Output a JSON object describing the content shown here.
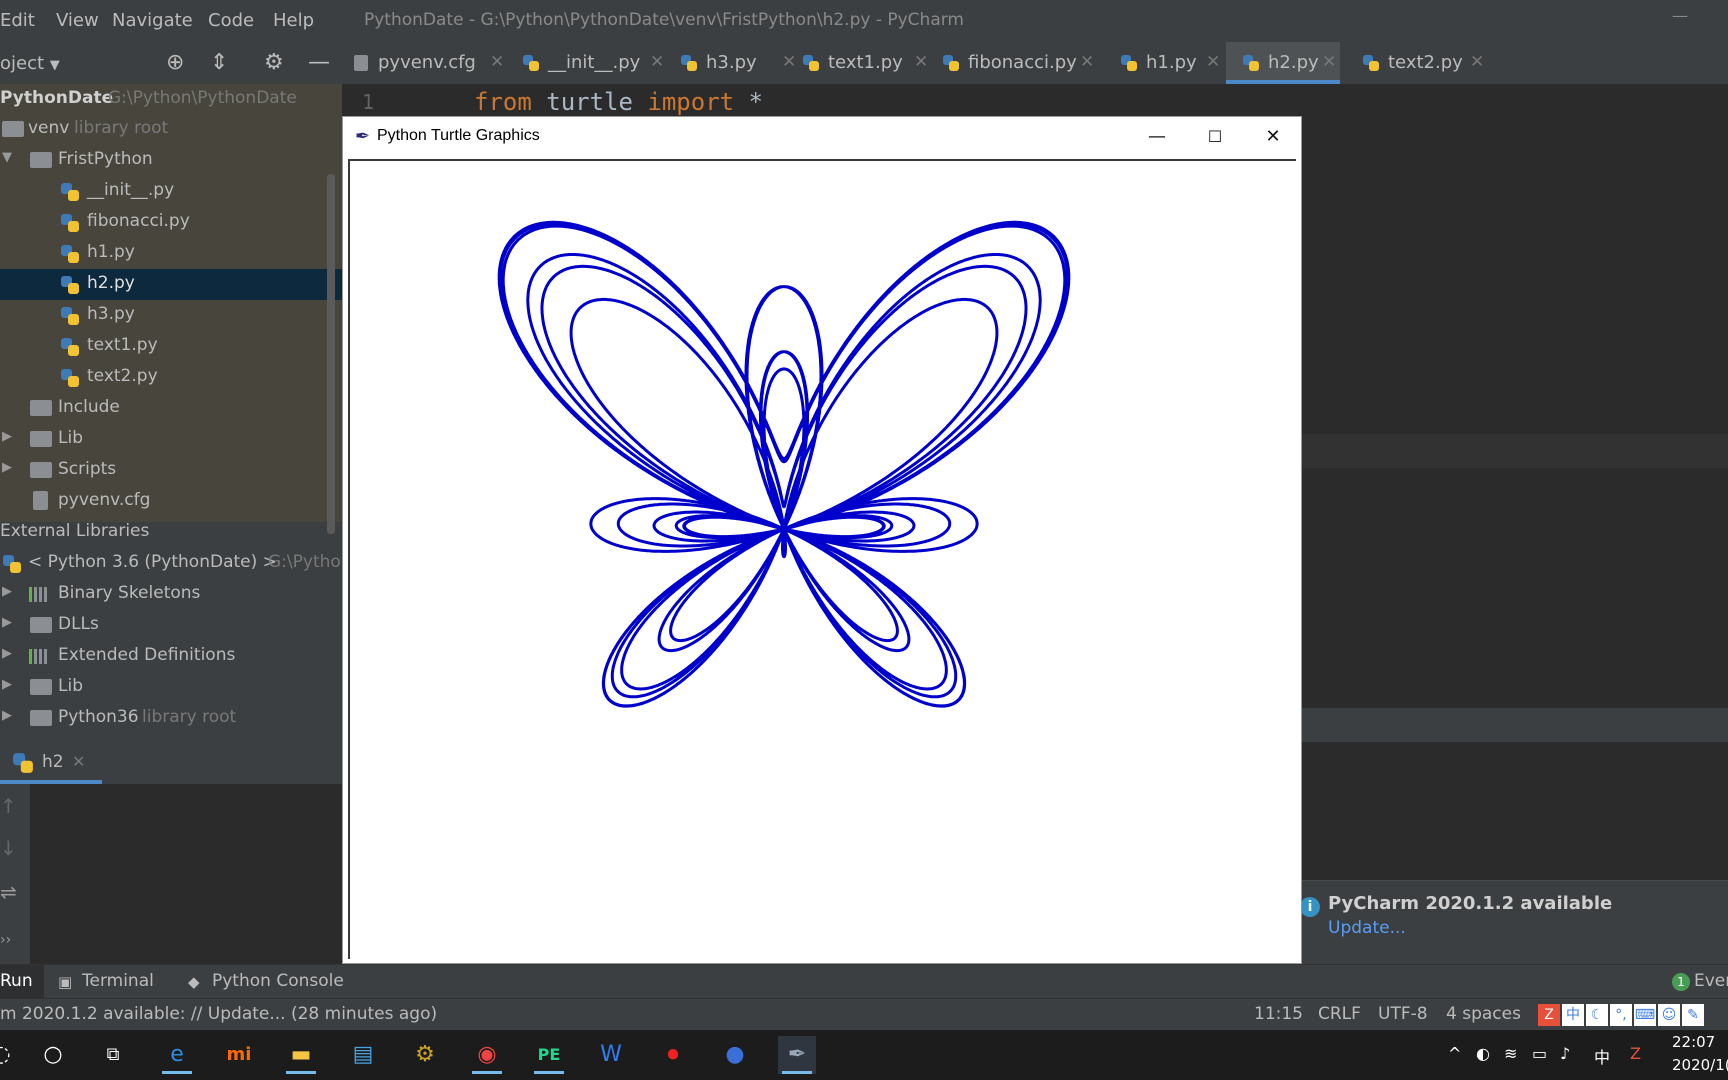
{
  "window_title": "PythonDate - G:\\Python\\PythonDate\\venv\\FristPython\\h2.py - PyCharm",
  "menu": [
    "Edit",
    "View",
    "Navigate",
    "Code",
    "Help"
  ],
  "project": {
    "label": "oject"
  },
  "tabs": [
    {
      "label": "pyvenv.cfg",
      "icon": "config-file-icon"
    },
    {
      "label": "__init__.py",
      "icon": "python-file-icon"
    },
    {
      "label": "h3.py",
      "icon": "python-file-icon"
    },
    {
      "label": "text1.py",
      "icon": "python-file-icon"
    },
    {
      "label": "fibonacci.py",
      "icon": "python-file-icon"
    },
    {
      "label": "h1.py",
      "icon": "python-file-icon"
    },
    {
      "label": "h2.py",
      "icon": "python-file-icon",
      "active": true
    },
    {
      "label": "text2.py",
      "icon": "python-file-icon"
    }
  ],
  "tree": {
    "root_name": "PythonDate",
    "root_path": "G:\\Python\\PythonDate",
    "venv_name": "venv",
    "venv_hint": "library root",
    "frist": "FristPython",
    "files": [
      "__init__.py",
      "fibonacci.py",
      "h1.py",
      "h2.py",
      "h3.py",
      "text1.py",
      "text2.py"
    ],
    "include": "Include",
    "lib": "Lib",
    "scripts": "Scripts",
    "pyvenv": "pyvenv.cfg",
    "external": "External Libraries",
    "python_sdk": "< Python 3.6 (PythonDate) >",
    "python_sdk_path": "G:\\Pytho",
    "binary": "Binary Skeletons",
    "dlls": "DLLs",
    "extended": "Extended Definitions",
    "lib2": "Lib",
    "python36": "Python36",
    "python36_hint": "library root"
  },
  "editor": {
    "line_number": "1",
    "code": {
      "kw1": "from",
      "mod": " turtle ",
      "kw2": "import",
      "rest": " *"
    }
  },
  "run_panel": {
    "tab_label": "h2"
  },
  "turtle_window": {
    "title": "Python Turtle Graphics",
    "pen_color": "#0000cc"
  },
  "notification": {
    "title": "PyCharm 2020.1.2 available",
    "link": "Update..."
  },
  "bottom_tools": {
    "run": "Run",
    "terminal": "Terminal",
    "console": "Python Console",
    "events_count": "1",
    "events": "Ever"
  },
  "status": {
    "message": "m 2020.1.2 available: // Update... (28 minutes ago)",
    "position": "11:15",
    "line_sep": "CRLF",
    "encoding": "UTF-8",
    "indent": "4 spaces"
  },
  "taskbar": {
    "tray_ime": "中",
    "time": "22:07",
    "date": "2020/1("
  }
}
